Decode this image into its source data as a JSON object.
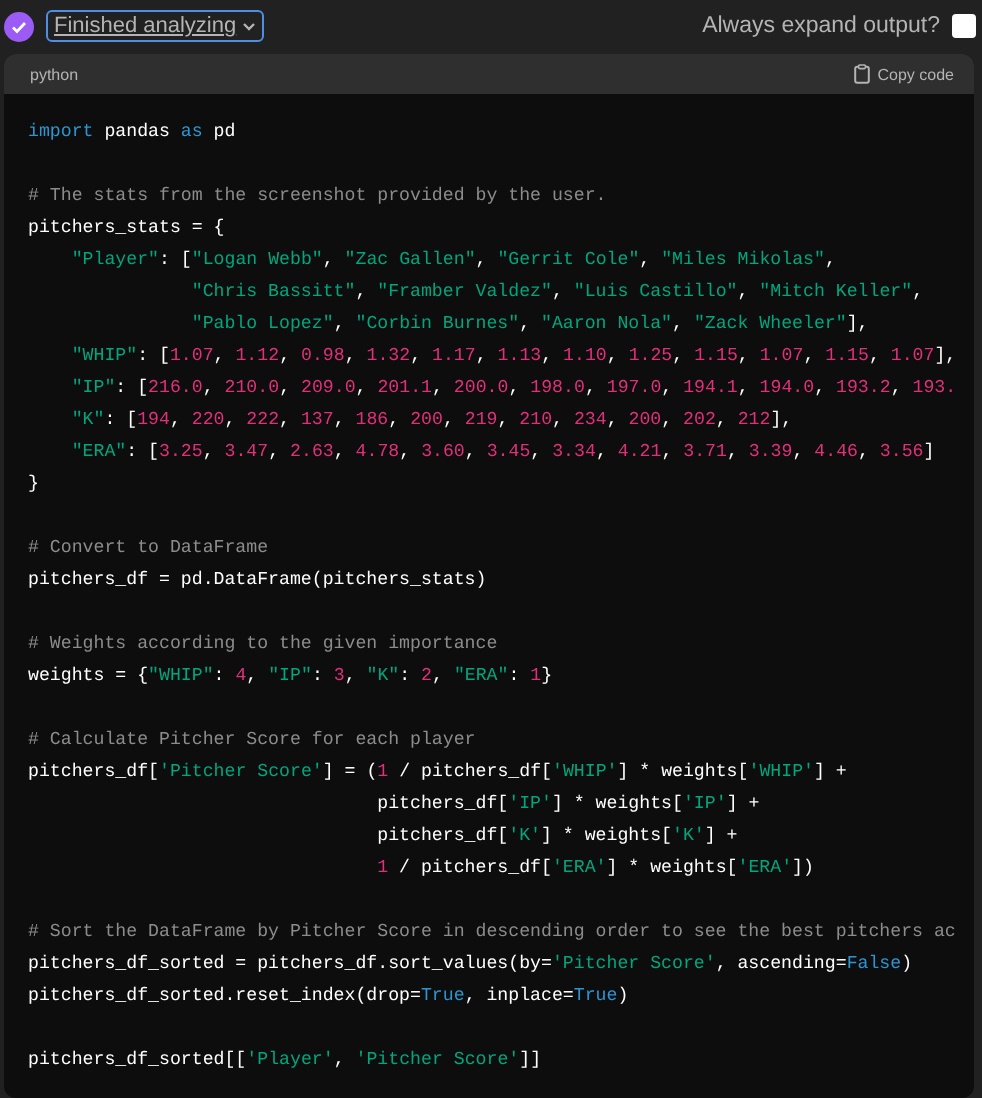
{
  "status": {
    "label": "Finished analyzing",
    "done": true
  },
  "expand_output": {
    "label": "Always expand output?",
    "checked": false
  },
  "code_block": {
    "language": "python",
    "copy_label": "Copy code",
    "blocks": [
      {
        "lines": [
          [
            {
              "kind": "keyword",
              "text": "import"
            },
            {
              "kind": "plain",
              "text": " pandas "
            },
            {
              "kind": "keyword",
              "text": "as"
            },
            {
              "kind": "plain",
              "text": " pd"
            }
          ]
        ]
      },
      {
        "lines": [
          [
            {
              "kind": "comment",
              "text": "# The stats from the screenshot provided by the user."
            }
          ],
          [
            {
              "kind": "plain",
              "text": "pitchers_stats = {"
            }
          ],
          [
            {
              "kind": "string",
              "text": "    \"Player\""
            },
            {
              "kind": "plain",
              "text": ": ["
            },
            {
              "kind": "string",
              "text": "\"Logan Webb\""
            },
            {
              "kind": "plain",
              "text": ", "
            },
            {
              "kind": "string",
              "text": "\"Zac Gallen\""
            },
            {
              "kind": "plain",
              "text": ", "
            },
            {
              "kind": "string",
              "text": "\"Gerrit Cole\""
            },
            {
              "kind": "plain",
              "text": ", "
            },
            {
              "kind": "string",
              "text": "\"Miles Mikolas\""
            },
            {
              "kind": "plain",
              "text": ","
            }
          ],
          [
            {
              "kind": "string",
              "text": "               \"Chris Bassitt\""
            },
            {
              "kind": "plain",
              "text": ", "
            },
            {
              "kind": "string",
              "text": "\"Framber Valdez\""
            },
            {
              "kind": "plain",
              "text": ", "
            },
            {
              "kind": "string",
              "text": "\"Luis Castillo\""
            },
            {
              "kind": "plain",
              "text": ", "
            },
            {
              "kind": "string",
              "text": "\"Mitch Keller\""
            },
            {
              "kind": "plain",
              "text": ","
            }
          ],
          [
            {
              "kind": "string",
              "text": "               \"Pablo Lopez\""
            },
            {
              "kind": "plain",
              "text": ", "
            },
            {
              "kind": "string",
              "text": "\"Corbin Burnes\""
            },
            {
              "kind": "plain",
              "text": ", "
            },
            {
              "kind": "string",
              "text": "\"Aaron Nola\""
            },
            {
              "kind": "plain",
              "text": ", "
            },
            {
              "kind": "string",
              "text": "\"Zack Wheeler\""
            },
            {
              "kind": "plain",
              "text": "],"
            }
          ],
          [
            {
              "kind": "string",
              "text": "    \"WHIP\""
            },
            {
              "kind": "plain",
              "text": ": ["
            },
            {
              "kind": "number",
              "text": "1.07"
            },
            {
              "kind": "plain",
              "text": ", "
            },
            {
              "kind": "number",
              "text": "1.12"
            },
            {
              "kind": "plain",
              "text": ", "
            },
            {
              "kind": "number",
              "text": "0.98"
            },
            {
              "kind": "plain",
              "text": ", "
            },
            {
              "kind": "number",
              "text": "1.32"
            },
            {
              "kind": "plain",
              "text": ", "
            },
            {
              "kind": "number",
              "text": "1.17"
            },
            {
              "kind": "plain",
              "text": ", "
            },
            {
              "kind": "number",
              "text": "1.13"
            },
            {
              "kind": "plain",
              "text": ", "
            },
            {
              "kind": "number",
              "text": "1.10"
            },
            {
              "kind": "plain",
              "text": ", "
            },
            {
              "kind": "number",
              "text": "1.25"
            },
            {
              "kind": "plain",
              "text": ", "
            },
            {
              "kind": "number",
              "text": "1.15"
            },
            {
              "kind": "plain",
              "text": ", "
            },
            {
              "kind": "number",
              "text": "1.07"
            },
            {
              "kind": "plain",
              "text": ", "
            },
            {
              "kind": "number",
              "text": "1.15"
            },
            {
              "kind": "plain",
              "text": ", "
            },
            {
              "kind": "number",
              "text": "1.07"
            },
            {
              "kind": "plain",
              "text": "],"
            }
          ],
          [
            {
              "kind": "string",
              "text": "    \"IP\""
            },
            {
              "kind": "plain",
              "text": ": ["
            },
            {
              "kind": "number",
              "text": "216.0"
            },
            {
              "kind": "plain",
              "text": ", "
            },
            {
              "kind": "number",
              "text": "210.0"
            },
            {
              "kind": "plain",
              "text": ", "
            },
            {
              "kind": "number",
              "text": "209.0"
            },
            {
              "kind": "plain",
              "text": ", "
            },
            {
              "kind": "number",
              "text": "201.1"
            },
            {
              "kind": "plain",
              "text": ", "
            },
            {
              "kind": "number",
              "text": "200.0"
            },
            {
              "kind": "plain",
              "text": ", "
            },
            {
              "kind": "number",
              "text": "198.0"
            },
            {
              "kind": "plain",
              "text": ", "
            },
            {
              "kind": "number",
              "text": "197.0"
            },
            {
              "kind": "plain",
              "text": ", "
            },
            {
              "kind": "number",
              "text": "194.1"
            },
            {
              "kind": "plain",
              "text": ", "
            },
            {
              "kind": "number",
              "text": "194.0"
            },
            {
              "kind": "plain",
              "text": ", "
            },
            {
              "kind": "number",
              "text": "193.2"
            },
            {
              "kind": "plain",
              "text": ", "
            },
            {
              "kind": "number",
              "text": "193."
            }
          ],
          [
            {
              "kind": "string",
              "text": "    \"K\""
            },
            {
              "kind": "plain",
              "text": ": ["
            },
            {
              "kind": "number",
              "text": "194"
            },
            {
              "kind": "plain",
              "text": ", "
            },
            {
              "kind": "number",
              "text": "220"
            },
            {
              "kind": "plain",
              "text": ", "
            },
            {
              "kind": "number",
              "text": "222"
            },
            {
              "kind": "plain",
              "text": ", "
            },
            {
              "kind": "number",
              "text": "137"
            },
            {
              "kind": "plain",
              "text": ", "
            },
            {
              "kind": "number",
              "text": "186"
            },
            {
              "kind": "plain",
              "text": ", "
            },
            {
              "kind": "number",
              "text": "200"
            },
            {
              "kind": "plain",
              "text": ", "
            },
            {
              "kind": "number",
              "text": "219"
            },
            {
              "kind": "plain",
              "text": ", "
            },
            {
              "kind": "number",
              "text": "210"
            },
            {
              "kind": "plain",
              "text": ", "
            },
            {
              "kind": "number",
              "text": "234"
            },
            {
              "kind": "plain",
              "text": ", "
            },
            {
              "kind": "number",
              "text": "200"
            },
            {
              "kind": "plain",
              "text": ", "
            },
            {
              "kind": "number",
              "text": "202"
            },
            {
              "kind": "plain",
              "text": ", "
            },
            {
              "kind": "number",
              "text": "212"
            },
            {
              "kind": "plain",
              "text": "],"
            }
          ],
          [
            {
              "kind": "string",
              "text": "    \"ERA\""
            },
            {
              "kind": "plain",
              "text": ": ["
            },
            {
              "kind": "number",
              "text": "3.25"
            },
            {
              "kind": "plain",
              "text": ", "
            },
            {
              "kind": "number",
              "text": "3.47"
            },
            {
              "kind": "plain",
              "text": ", "
            },
            {
              "kind": "number",
              "text": "2.63"
            },
            {
              "kind": "plain",
              "text": ", "
            },
            {
              "kind": "number",
              "text": "4.78"
            },
            {
              "kind": "plain",
              "text": ", "
            },
            {
              "kind": "number",
              "text": "3.60"
            },
            {
              "kind": "plain",
              "text": ", "
            },
            {
              "kind": "number",
              "text": "3.45"
            },
            {
              "kind": "plain",
              "text": ", "
            },
            {
              "kind": "number",
              "text": "3.34"
            },
            {
              "kind": "plain",
              "text": ", "
            },
            {
              "kind": "number",
              "text": "4.21"
            },
            {
              "kind": "plain",
              "text": ", "
            },
            {
              "kind": "number",
              "text": "3.71"
            },
            {
              "kind": "plain",
              "text": ", "
            },
            {
              "kind": "number",
              "text": "3.39"
            },
            {
              "kind": "plain",
              "text": ", "
            },
            {
              "kind": "number",
              "text": "4.46"
            },
            {
              "kind": "plain",
              "text": ", "
            },
            {
              "kind": "number",
              "text": "3.56"
            },
            {
              "kind": "plain",
              "text": "]"
            }
          ],
          [
            {
              "kind": "plain",
              "text": "}"
            }
          ]
        ]
      },
      {
        "lines": [
          [
            {
              "kind": "comment",
              "text": "# Convert to DataFrame"
            }
          ],
          [
            {
              "kind": "plain",
              "text": "pitchers_df = pd.DataFrame(pitchers_stats)"
            }
          ]
        ]
      },
      {
        "lines": [
          [
            {
              "kind": "comment",
              "text": "# Weights according to the given importance"
            }
          ],
          [
            {
              "kind": "plain",
              "text": "weights = {"
            },
            {
              "kind": "string",
              "text": "\"WHIP\""
            },
            {
              "kind": "plain",
              "text": ": "
            },
            {
              "kind": "number",
              "text": "4"
            },
            {
              "kind": "plain",
              "text": ", "
            },
            {
              "kind": "string",
              "text": "\"IP\""
            },
            {
              "kind": "plain",
              "text": ": "
            },
            {
              "kind": "number",
              "text": "3"
            },
            {
              "kind": "plain",
              "text": ", "
            },
            {
              "kind": "string",
              "text": "\"K\""
            },
            {
              "kind": "plain",
              "text": ": "
            },
            {
              "kind": "number",
              "text": "2"
            },
            {
              "kind": "plain",
              "text": ", "
            },
            {
              "kind": "string",
              "text": "\"ERA\""
            },
            {
              "kind": "plain",
              "text": ": "
            },
            {
              "kind": "number",
              "text": "1"
            },
            {
              "kind": "plain",
              "text": "}"
            }
          ]
        ]
      },
      {
        "lines": [
          [
            {
              "kind": "comment",
              "text": "# Calculate Pitcher Score for each player"
            }
          ],
          [
            {
              "kind": "plain",
              "text": "pitchers_df["
            },
            {
              "kind": "string",
              "text": "'Pitcher Score'"
            },
            {
              "kind": "plain",
              "text": "] = ("
            },
            {
              "kind": "number",
              "text": "1"
            },
            {
              "kind": "plain",
              "text": " / pitchers_df["
            },
            {
              "kind": "string",
              "text": "'WHIP'"
            },
            {
              "kind": "plain",
              "text": "] * weights["
            },
            {
              "kind": "string",
              "text": "'WHIP'"
            },
            {
              "kind": "plain",
              "text": "] +"
            }
          ],
          [
            {
              "kind": "plain",
              "text": "                                pitchers_df["
            },
            {
              "kind": "string",
              "text": "'IP'"
            },
            {
              "kind": "plain",
              "text": "] * weights["
            },
            {
              "kind": "string",
              "text": "'IP'"
            },
            {
              "kind": "plain",
              "text": "] +"
            }
          ],
          [
            {
              "kind": "plain",
              "text": "                                pitchers_df["
            },
            {
              "kind": "string",
              "text": "'K'"
            },
            {
              "kind": "plain",
              "text": "] * weights["
            },
            {
              "kind": "string",
              "text": "'K'"
            },
            {
              "kind": "plain",
              "text": "] +"
            }
          ],
          [
            {
              "kind": "number",
              "text": "                                1"
            },
            {
              "kind": "plain",
              "text": " / pitchers_df["
            },
            {
              "kind": "string",
              "text": "'ERA'"
            },
            {
              "kind": "plain",
              "text": "] * weights["
            },
            {
              "kind": "string",
              "text": "'ERA'"
            },
            {
              "kind": "plain",
              "text": "])"
            }
          ]
        ]
      },
      {
        "lines": [
          [
            {
              "kind": "comment",
              "text": "# Sort the DataFrame by Pitcher Score in descending order to see the best pitchers ac"
            }
          ],
          [
            {
              "kind": "plain",
              "text": "pitchers_df_sorted = pitchers_df.sort_values(by="
            },
            {
              "kind": "string",
              "text": "'Pitcher Score'"
            },
            {
              "kind": "plain",
              "text": ", ascending="
            },
            {
              "kind": "keyword",
              "text": "False"
            },
            {
              "kind": "plain",
              "text": ")"
            }
          ],
          [
            {
              "kind": "plain",
              "text": "pitchers_df_sorted.reset_index(drop="
            },
            {
              "kind": "keyword",
              "text": "True"
            },
            {
              "kind": "plain",
              "text": ", inplace="
            },
            {
              "kind": "keyword",
              "text": "True"
            },
            {
              "kind": "plain",
              "text": ")"
            }
          ]
        ]
      },
      {
        "lines": [
          [
            {
              "kind": "plain",
              "text": "pitchers_df_sorted[["
            },
            {
              "kind": "string",
              "text": "'Player'"
            },
            {
              "kind": "plain",
              "text": ", "
            },
            {
              "kind": "string",
              "text": "'Pitcher Score'"
            },
            {
              "kind": "plain",
              "text": "]]"
            }
          ]
        ]
      }
    ]
  }
}
